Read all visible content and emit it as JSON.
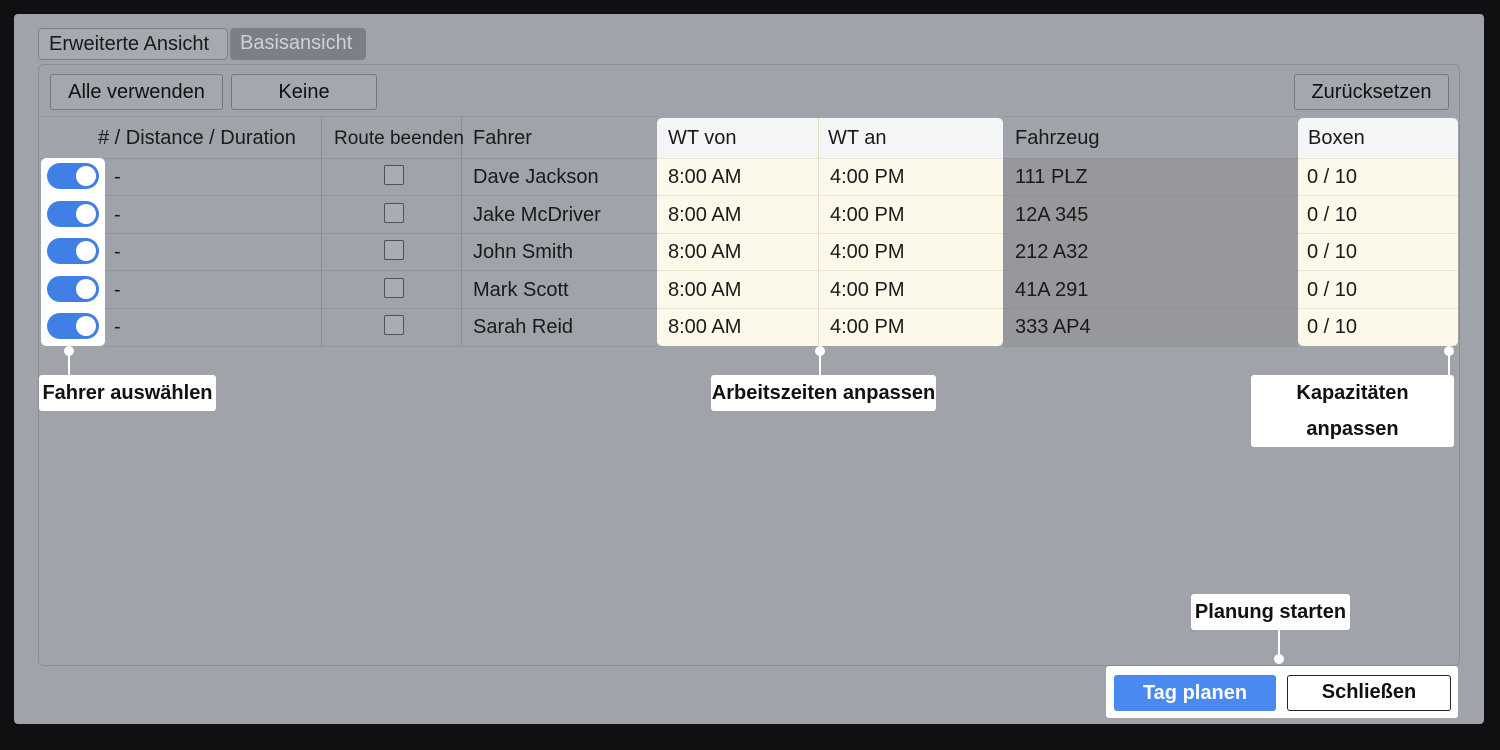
{
  "tabs": [
    {
      "label": "Erweiterte Ansicht",
      "active": true
    },
    {
      "label": "Basisansicht",
      "active": false
    }
  ],
  "toolbar": {
    "use_all_label": "Alle verwenden",
    "none_label": "Keine",
    "reset_label": "Zurücksetzen"
  },
  "table": {
    "headers": {
      "distance": "# / Distance / Duration",
      "end_route": "Route beenden",
      "driver": "Fahrer",
      "wt_from": "WT von",
      "wt_to": "WT an",
      "vehicle": "Fahrzeug",
      "boxes": "Boxen"
    },
    "rows": [
      {
        "enabled": true,
        "distance": "-",
        "end_route": false,
        "driver": "Dave Jackson",
        "wt_from": "8:00 AM",
        "wt_to": "4:00 PM",
        "vehicle": "111 PLZ",
        "boxes": "0 / 10"
      },
      {
        "enabled": true,
        "distance": "-",
        "end_route": false,
        "driver": "Jake McDriver",
        "wt_from": "8:00 AM",
        "wt_to": "4:00 PM",
        "vehicle": "12A 345",
        "boxes": "0 / 10"
      },
      {
        "enabled": true,
        "distance": "-",
        "end_route": false,
        "driver": "John Smith",
        "wt_from": "8:00 AM",
        "wt_to": "4:00 PM",
        "vehicle": "212 A32",
        "boxes": "0 / 10"
      },
      {
        "enabled": true,
        "distance": "-",
        "end_route": false,
        "driver": "Mark Scott",
        "wt_from": "8:00 AM",
        "wt_to": "4:00 PM",
        "vehicle": "41A 291",
        "boxes": "0 / 10"
      },
      {
        "enabled": true,
        "distance": "-",
        "end_route": false,
        "driver": "Sarah Reid",
        "wt_from": "8:00 AM",
        "wt_to": "4:00 PM",
        "vehicle": "333 AP4",
        "boxes": "0 / 10"
      }
    ]
  },
  "callouts": {
    "select_driver": "Fahrer auswählen",
    "work_hours": "Arbeitszeiten anpassen",
    "capacities": "Kapazitäten anpassen",
    "start_planning": "Planung starten"
  },
  "actions": {
    "plan_day_label": "Tag planen",
    "close_label": "Schließen"
  },
  "colors": {
    "accent": "#4a8af0",
    "toggle_on": "#3f7fe6",
    "highlight": "#fcf9ea"
  }
}
